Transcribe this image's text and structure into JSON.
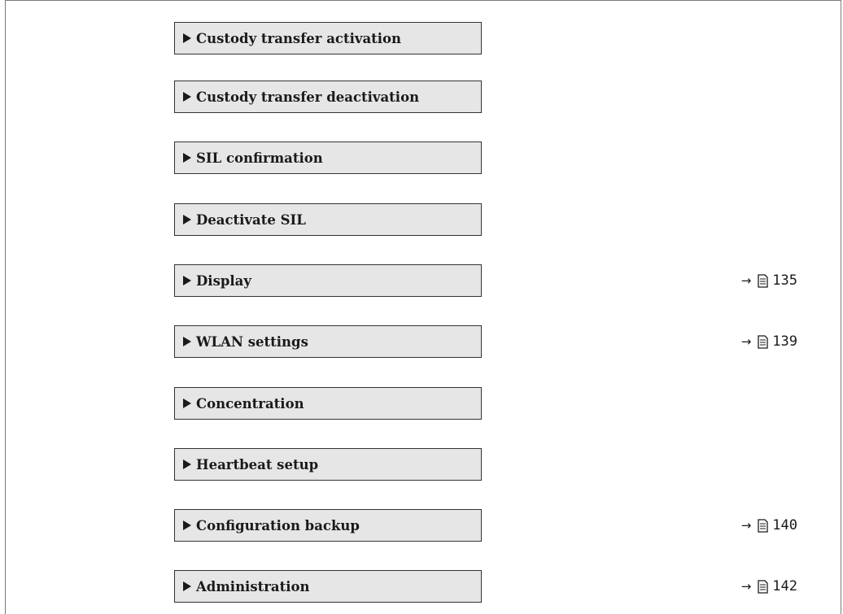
{
  "menu": {
    "items": [
      {
        "label": "Custody transfer activation",
        "ref": ""
      },
      {
        "label": "Custody transfer deactivation",
        "ref": ""
      },
      {
        "label": "SIL confirmation",
        "ref": ""
      },
      {
        "label": "Deactivate SIL",
        "ref": ""
      },
      {
        "label": "Display",
        "ref": "135"
      },
      {
        "label": "WLAN settings",
        "ref": "139"
      },
      {
        "label": "Concentration",
        "ref": ""
      },
      {
        "label": "Heartbeat setup",
        "ref": ""
      },
      {
        "label": "Configuration backup",
        "ref": "140"
      },
      {
        "label": "Administration",
        "ref": "142"
      }
    ],
    "submenu_icon": "right-triangle-icon",
    "reference_arrow": "→",
    "reference_icon": "page-reference-icon"
  }
}
